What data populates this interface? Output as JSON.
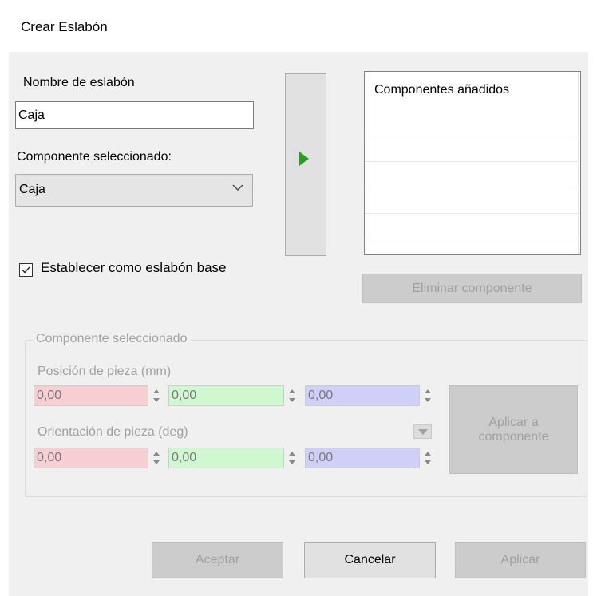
{
  "window": {
    "title": "Crear Eslabón"
  },
  "link_name": {
    "label": "Nombre de eslabón",
    "value": "Caja"
  },
  "component_select": {
    "label": "Componente seleccionado:",
    "value": "Caja"
  },
  "added_list": {
    "header": "Componentes añadidos",
    "items": []
  },
  "base_link": {
    "label": "Establecer como eslabón base",
    "checked": true
  },
  "remove_button": {
    "label": "Eliminar componente"
  },
  "selected_group": {
    "title": "Componente seleccionado",
    "position": {
      "label": "Posición de pieza (mm)",
      "x": "0,00",
      "y": "0,00",
      "z": "0,00"
    },
    "orientation": {
      "label": "Orientación de pieza (deg)",
      "x": "0,00",
      "y": "0,00",
      "z": "0,00"
    },
    "apply_component": {
      "label_line1": "Aplicar a",
      "label_line2": "componente"
    }
  },
  "footer": {
    "accept": "Aceptar",
    "cancel": "Cancelar",
    "apply": "Aplicar"
  },
  "colors": {
    "x_field": "#f7cfd3",
    "y_field": "#cff7d0",
    "z_field": "#cfcff7",
    "play_arrow": "#1fa31f"
  },
  "icons": [
    "play-arrow-icon",
    "chevron-down-icon",
    "check-icon",
    "spin-up-icon",
    "spin-down-icon",
    "dropdown-triangle-icon"
  ]
}
